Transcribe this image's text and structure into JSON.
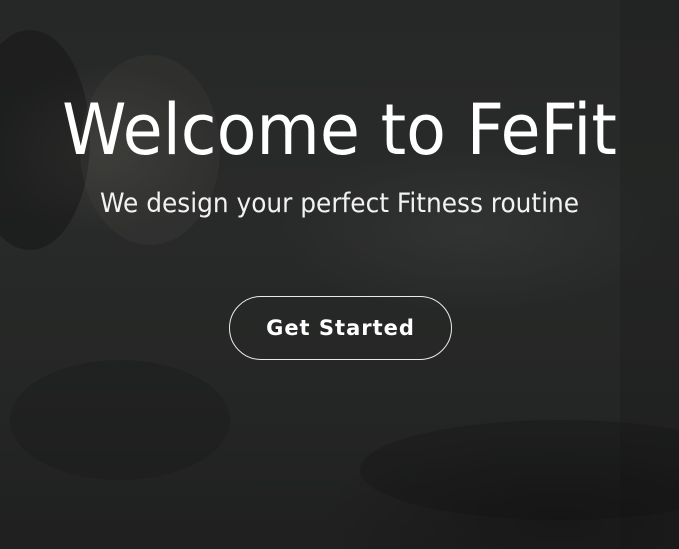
{
  "hero": {
    "title": "Welcome to FeFit",
    "subtitle": "We design your perfect Fitness routine",
    "cta_label": "Get Started"
  },
  "colors": {
    "text": "#ffffff",
    "background": "#2d2f2e",
    "button_border": "#ffffff"
  }
}
